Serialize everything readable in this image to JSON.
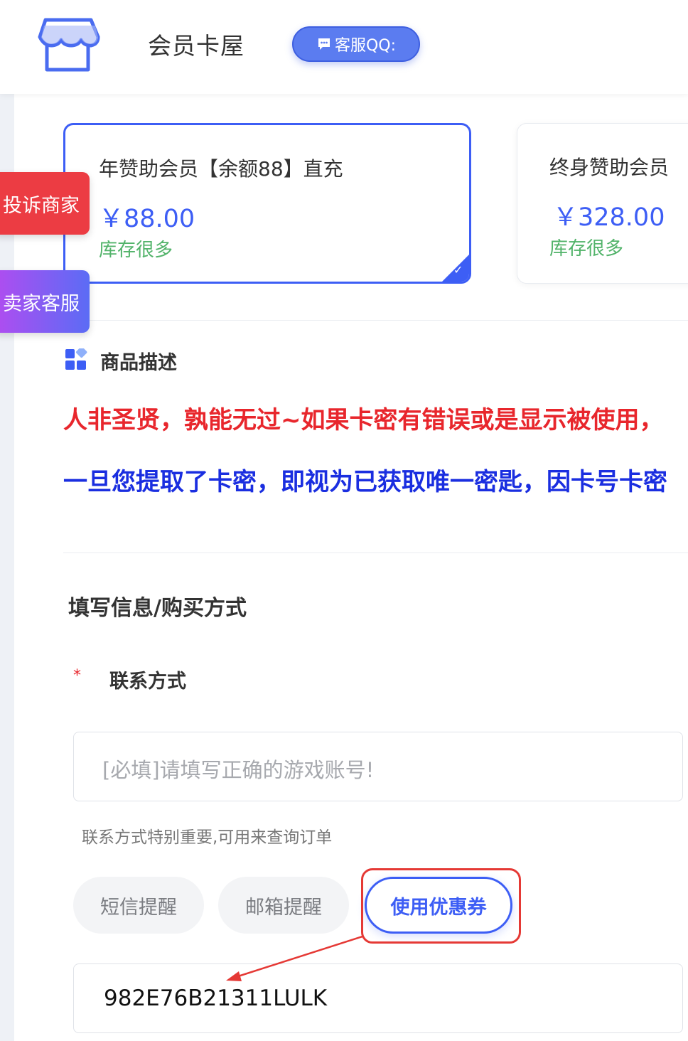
{
  "header": {
    "site_name": "会员卡屋",
    "qq_button": "客服QQ:"
  },
  "floating": {
    "complain": "投诉商家",
    "seller_service": "卖家客服"
  },
  "products": [
    {
      "title": "年赞助会员【余额88】直充",
      "price": "￥88.00",
      "stock": "库存很多",
      "selected": true
    },
    {
      "title": "终身赞助会员",
      "price": "￥328.00",
      "stock": "库存很多",
      "selected": false
    }
  ],
  "description": {
    "title": "商品描述",
    "line_red": "人非圣贤，孰能无过~如果卡密有错误或是显示被使用，",
    "line_blue": "一旦您提取了卡密，即视为已获取唯一密匙，因卡号卡密"
  },
  "form": {
    "section_title": "填写信息/购买方式",
    "required_mark": "*",
    "contact_label": "联系方式",
    "contact_placeholder": "[必填]请填写正确的游戏账号!",
    "contact_hint": "联系方式特别重要,可用来查询订单",
    "sms_reminder": "短信提醒",
    "email_reminder": "邮箱提醒",
    "use_coupon": "使用优惠券",
    "coupon_code": "982E76B21311LULK"
  },
  "colors": {
    "accent": "#3d5ef5",
    "red_text": "#e8262c",
    "blue_text": "#1a2ee0",
    "stock_green": "#52b36a",
    "annotation_red": "#e53935"
  }
}
